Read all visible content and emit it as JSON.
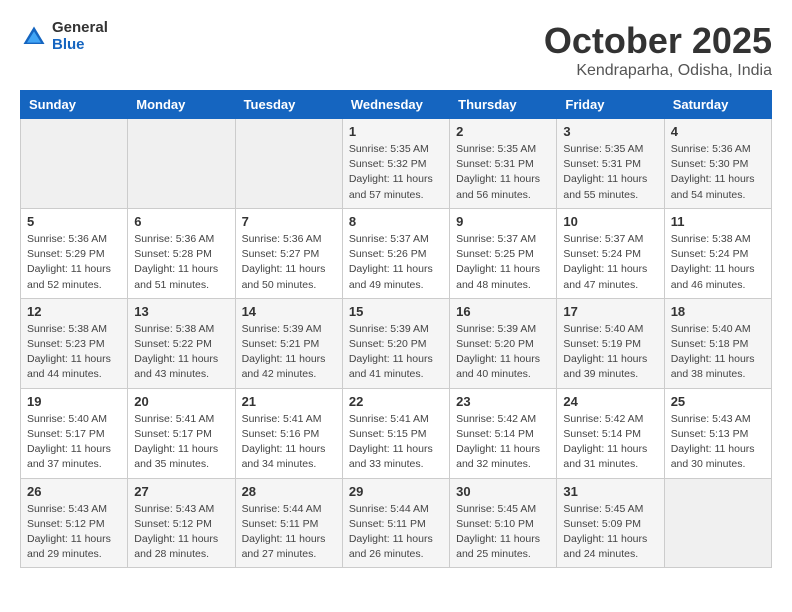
{
  "header": {
    "logo_general": "General",
    "logo_blue": "Blue",
    "month_title": "October 2025",
    "location": "Kendraparha, Odisha, India"
  },
  "calendar": {
    "days_of_week": [
      "Sunday",
      "Monday",
      "Tuesday",
      "Wednesday",
      "Thursday",
      "Friday",
      "Saturday"
    ],
    "weeks": [
      [
        {
          "day": "",
          "info": ""
        },
        {
          "day": "",
          "info": ""
        },
        {
          "day": "",
          "info": ""
        },
        {
          "day": "1",
          "info": "Sunrise: 5:35 AM\nSunset: 5:32 PM\nDaylight: 11 hours\nand 57 minutes."
        },
        {
          "day": "2",
          "info": "Sunrise: 5:35 AM\nSunset: 5:31 PM\nDaylight: 11 hours\nand 56 minutes."
        },
        {
          "day": "3",
          "info": "Sunrise: 5:35 AM\nSunset: 5:31 PM\nDaylight: 11 hours\nand 55 minutes."
        },
        {
          "day": "4",
          "info": "Sunrise: 5:36 AM\nSunset: 5:30 PM\nDaylight: 11 hours\nand 54 minutes."
        }
      ],
      [
        {
          "day": "5",
          "info": "Sunrise: 5:36 AM\nSunset: 5:29 PM\nDaylight: 11 hours\nand 52 minutes."
        },
        {
          "day": "6",
          "info": "Sunrise: 5:36 AM\nSunset: 5:28 PM\nDaylight: 11 hours\nand 51 minutes."
        },
        {
          "day": "7",
          "info": "Sunrise: 5:36 AM\nSunset: 5:27 PM\nDaylight: 11 hours\nand 50 minutes."
        },
        {
          "day": "8",
          "info": "Sunrise: 5:37 AM\nSunset: 5:26 PM\nDaylight: 11 hours\nand 49 minutes."
        },
        {
          "day": "9",
          "info": "Sunrise: 5:37 AM\nSunset: 5:25 PM\nDaylight: 11 hours\nand 48 minutes."
        },
        {
          "day": "10",
          "info": "Sunrise: 5:37 AM\nSunset: 5:24 PM\nDaylight: 11 hours\nand 47 minutes."
        },
        {
          "day": "11",
          "info": "Sunrise: 5:38 AM\nSunset: 5:24 PM\nDaylight: 11 hours\nand 46 minutes."
        }
      ],
      [
        {
          "day": "12",
          "info": "Sunrise: 5:38 AM\nSunset: 5:23 PM\nDaylight: 11 hours\nand 44 minutes."
        },
        {
          "day": "13",
          "info": "Sunrise: 5:38 AM\nSunset: 5:22 PM\nDaylight: 11 hours\nand 43 minutes."
        },
        {
          "day": "14",
          "info": "Sunrise: 5:39 AM\nSunset: 5:21 PM\nDaylight: 11 hours\nand 42 minutes."
        },
        {
          "day": "15",
          "info": "Sunrise: 5:39 AM\nSunset: 5:20 PM\nDaylight: 11 hours\nand 41 minutes."
        },
        {
          "day": "16",
          "info": "Sunrise: 5:39 AM\nSunset: 5:20 PM\nDaylight: 11 hours\nand 40 minutes."
        },
        {
          "day": "17",
          "info": "Sunrise: 5:40 AM\nSunset: 5:19 PM\nDaylight: 11 hours\nand 39 minutes."
        },
        {
          "day": "18",
          "info": "Sunrise: 5:40 AM\nSunset: 5:18 PM\nDaylight: 11 hours\nand 38 minutes."
        }
      ],
      [
        {
          "day": "19",
          "info": "Sunrise: 5:40 AM\nSunset: 5:17 PM\nDaylight: 11 hours\nand 37 minutes."
        },
        {
          "day": "20",
          "info": "Sunrise: 5:41 AM\nSunset: 5:17 PM\nDaylight: 11 hours\nand 35 minutes."
        },
        {
          "day": "21",
          "info": "Sunrise: 5:41 AM\nSunset: 5:16 PM\nDaylight: 11 hours\nand 34 minutes."
        },
        {
          "day": "22",
          "info": "Sunrise: 5:41 AM\nSunset: 5:15 PM\nDaylight: 11 hours\nand 33 minutes."
        },
        {
          "day": "23",
          "info": "Sunrise: 5:42 AM\nSunset: 5:14 PM\nDaylight: 11 hours\nand 32 minutes."
        },
        {
          "day": "24",
          "info": "Sunrise: 5:42 AM\nSunset: 5:14 PM\nDaylight: 11 hours\nand 31 minutes."
        },
        {
          "day": "25",
          "info": "Sunrise: 5:43 AM\nSunset: 5:13 PM\nDaylight: 11 hours\nand 30 minutes."
        }
      ],
      [
        {
          "day": "26",
          "info": "Sunrise: 5:43 AM\nSunset: 5:12 PM\nDaylight: 11 hours\nand 29 minutes."
        },
        {
          "day": "27",
          "info": "Sunrise: 5:43 AM\nSunset: 5:12 PM\nDaylight: 11 hours\nand 28 minutes."
        },
        {
          "day": "28",
          "info": "Sunrise: 5:44 AM\nSunset: 5:11 PM\nDaylight: 11 hours\nand 27 minutes."
        },
        {
          "day": "29",
          "info": "Sunrise: 5:44 AM\nSunset: 5:11 PM\nDaylight: 11 hours\nand 26 minutes."
        },
        {
          "day": "30",
          "info": "Sunrise: 5:45 AM\nSunset: 5:10 PM\nDaylight: 11 hours\nand 25 minutes."
        },
        {
          "day": "31",
          "info": "Sunrise: 5:45 AM\nSunset: 5:09 PM\nDaylight: 11 hours\nand 24 minutes."
        },
        {
          "day": "",
          "info": ""
        }
      ]
    ]
  }
}
